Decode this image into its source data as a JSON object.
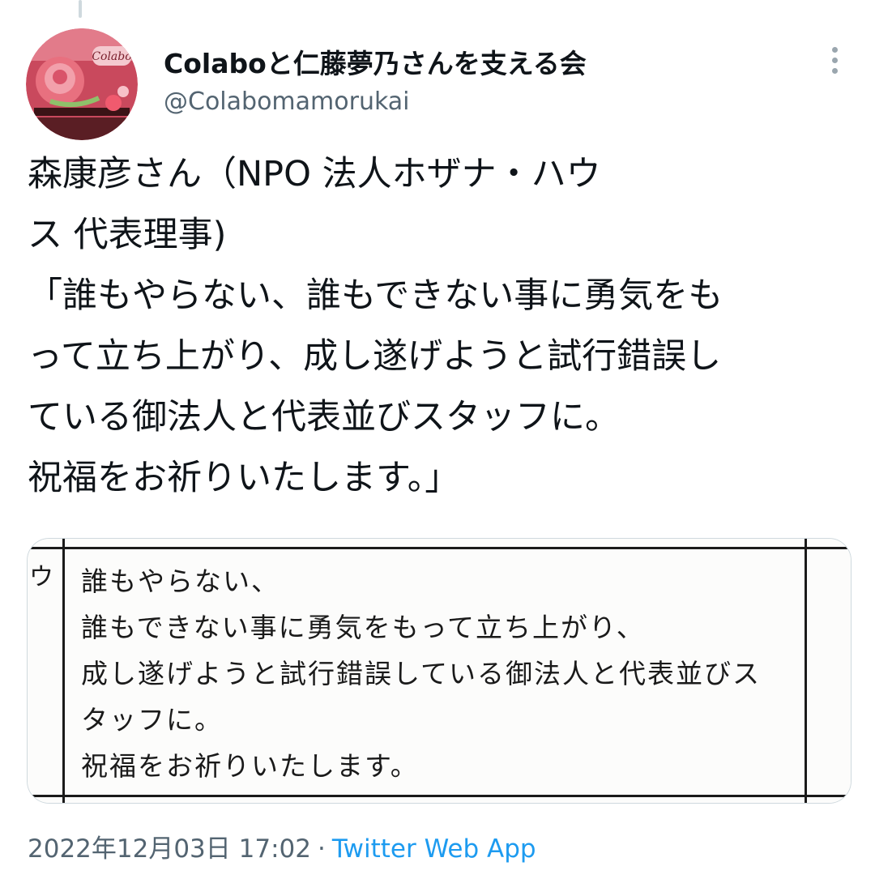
{
  "author": {
    "display_name": "Colaboと仁藤夢乃さんを支える会",
    "handle": "@Colabomamorukai",
    "avatar_logo_text": "Colabo"
  },
  "tweet": {
    "lines": [
      "森康彦さん（NPO 法人ホザナ・ハウ",
      "ス 代表理事)",
      "「誰もやらない、誰もできない事に勇気をも",
      "って立ち上がり、成し遂げようと試行錯誤し",
      "ている御法人と代表並びスタッフに。",
      "祝福をお祈りいたします。」"
    ]
  },
  "media": {
    "side_label": "ウ",
    "lines": [
      "誰もやらない、",
      "誰もできない事に勇気をもって立ち上がり、",
      "成し遂げようと試行錯誤している御法人と代表並びス",
      "タッフに。",
      "祝福をお祈りいたします。"
    ]
  },
  "meta": {
    "timestamp": "2022年12月03日 17:02",
    "separator": "·",
    "source_app": "Twitter Web App"
  },
  "colors": {
    "link": "#1d9bf0",
    "secondary_text": "#536471",
    "primary_text": "#0f1419",
    "avatar_bg": "#d9546a"
  }
}
